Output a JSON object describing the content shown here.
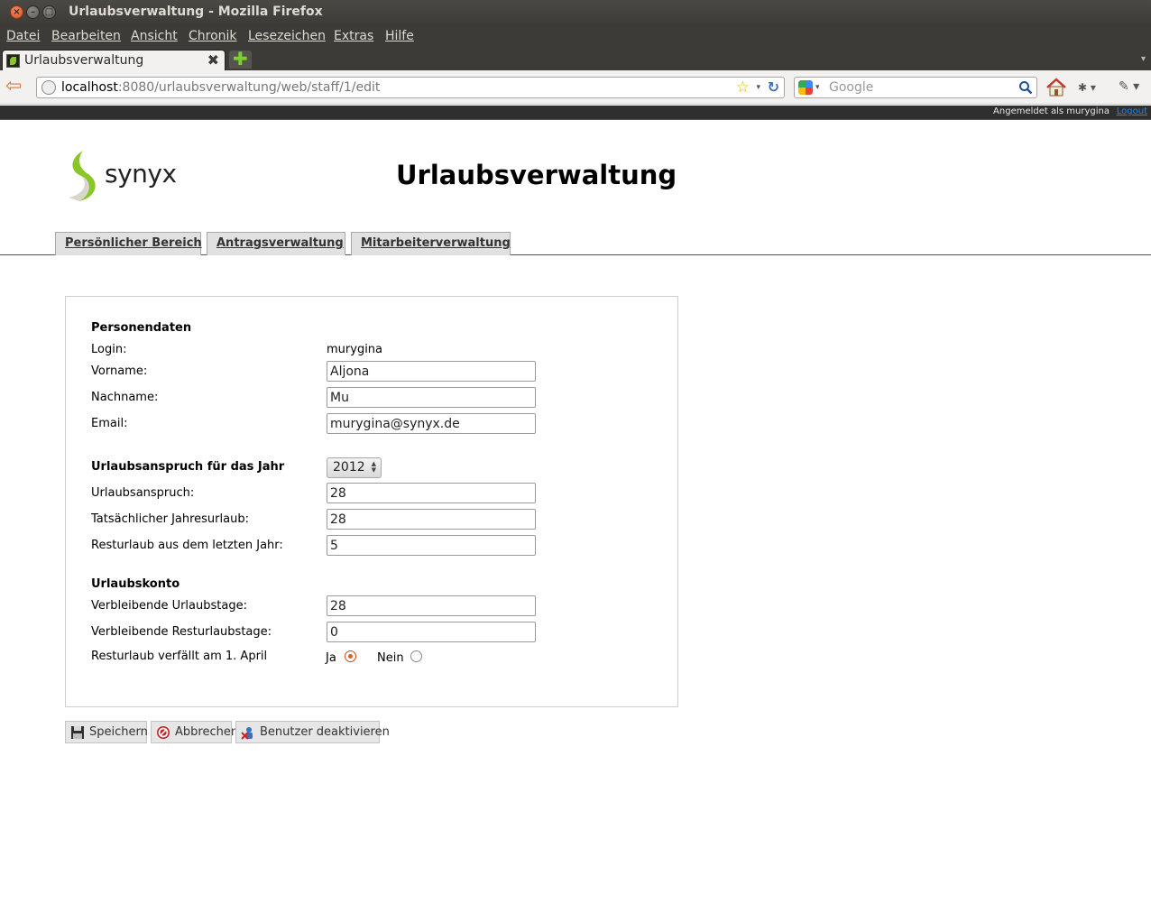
{
  "window": {
    "title": "Urlaubsverwaltung - Mozilla Firefox",
    "close_glyph": "×",
    "min_glyph": "–",
    "max_glyph": "□"
  },
  "menu": [
    "Datei",
    "Bearbeiten",
    "Ansicht",
    "Chronik",
    "Lesezeichen",
    "Extras",
    "Hilfe"
  ],
  "tab": {
    "label": "Urlaubsverwaltung",
    "close_glyph": "✖",
    "new_glyph": "✚",
    "list_glyph": "▾"
  },
  "navbar": {
    "url_host": "localhost",
    "url_rest": ":8080/urlaubsverwaltung/web/staff/1/edit",
    "search_placeholder": "Google",
    "back_glyph": "⇦",
    "star_glyph": "☆",
    "reload_glyph": "↻",
    "dd_glyph": "▾"
  },
  "session": {
    "logged_in_as": "Angemeldet als murygina",
    "logout": "Logout"
  },
  "header": {
    "logo_text": "synyx",
    "title": "Urlaubsverwaltung"
  },
  "nav_tabs": [
    "Persönlicher Bereich",
    "Antragsverwaltung",
    "Mitarbeiterverwaltung"
  ],
  "form": {
    "person_section": "Personendaten",
    "login_label": "Login:",
    "login_value": "murygina",
    "firstname_label": "Vorname:",
    "firstname_value": "Aljona",
    "lastname_label": "Nachname:",
    "lastname_value": "Mu",
    "email_label": "Email:",
    "email_value": "murygina@synyx.de",
    "entitlement_section": "Urlaubsanspruch für das Jahr",
    "year_value": "2012",
    "entitlement_label": "Urlaubsanspruch:",
    "entitlement_value": "28",
    "actual_label": "Tatsächlicher Jahresurlaub:",
    "actual_value": "28",
    "remaining_last_year_label": "Resturlaub aus dem letzten Jahr:",
    "remaining_last_year_value": "5",
    "account_section": "Urlaubskonto",
    "remaining_days_label": "Verbleibende Urlaubstage:",
    "remaining_days_value": "28",
    "remaining_rest_label": "Verbleibende Resturlaubstage:",
    "remaining_rest_value": "0",
    "expires_label": "Resturlaub verfällt am 1. April",
    "yes_label": "Ja",
    "no_label": "Nein",
    "expires_selected": "Ja"
  },
  "buttons": {
    "save": "Speichern",
    "cancel": "Abbrechen",
    "deactivate": "Benutzer deaktivieren"
  },
  "colors": {
    "chrome_dark": "#3c3b37",
    "accent_orange": "#e25e1a",
    "link_blue": "#2c86d8",
    "logo_green": "#8ac52a"
  }
}
